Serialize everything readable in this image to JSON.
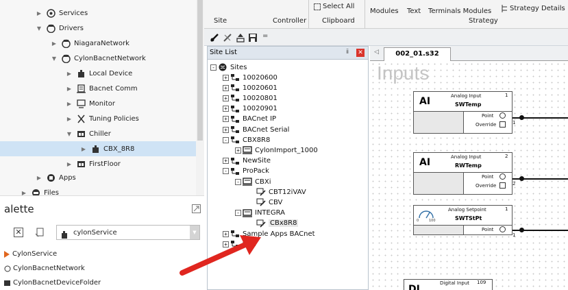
{
  "nav": {
    "items": [
      {
        "label": "Services",
        "icon": "gear-icon",
        "expanded": false
      },
      {
        "label": "Drivers",
        "icon": "driver-icon",
        "expanded": true
      },
      {
        "label": "NiagaraNetwork",
        "icon": "network-icon",
        "expanded": false
      },
      {
        "label": "CylonBacnetNetwork",
        "icon": "network-icon",
        "expanded": true
      },
      {
        "label": "Local Device",
        "icon": "device-icon",
        "expanded": false
      },
      {
        "label": "Bacnet Comm",
        "icon": "comm-icon",
        "expanded": false
      },
      {
        "label": "Monitor",
        "icon": "monitor-icon",
        "expanded": false
      },
      {
        "label": "Tuning Policies",
        "icon": "tuning-icon",
        "expanded": false
      },
      {
        "label": "Chiller",
        "icon": "folder-icon",
        "expanded": true
      },
      {
        "label": "CBX_8R8",
        "icon": "device-icon",
        "expanded": false,
        "selected": true
      },
      {
        "label": "FirstFloor",
        "icon": "folder-icon",
        "expanded": false
      },
      {
        "label": "Apps",
        "icon": "apps-icon",
        "expanded": false
      },
      {
        "label": "Files",
        "icon": "files-icon",
        "expanded": false
      }
    ]
  },
  "palette": {
    "title": "alette",
    "service_select": "cylonService",
    "items": [
      {
        "label": "CylonService",
        "icon": "service-icon"
      },
      {
        "label": "CylonBacnetNetwork",
        "icon": "network-icon"
      },
      {
        "label": "CylonBacnetDeviceFolder",
        "icon": "folder-icon"
      }
    ]
  },
  "ribbon": {
    "groups": [
      "Site",
      "Controller",
      "Clipboard"
    ],
    "select_all": "Select All",
    "modules": "Modules",
    "text": "Text",
    "terminals_modules": "Terminals Modules",
    "strategy_details": "Strategy Details",
    "strategy_group": "Strategy"
  },
  "toolbar2": {
    "overflow": "="
  },
  "sitelist": {
    "title": "Site List",
    "root": "Sites",
    "items": [
      {
        "label": "10020600",
        "level": 1,
        "icon": "site-icon",
        "toggle": "+"
      },
      {
        "label": "10020601",
        "level": 1,
        "icon": "site-icon",
        "toggle": "+"
      },
      {
        "label": "10020801",
        "level": 1,
        "icon": "site-icon",
        "toggle": "+"
      },
      {
        "label": "10020901",
        "level": 1,
        "icon": "site-icon",
        "toggle": "+"
      },
      {
        "label": "BACnet IP",
        "level": 1,
        "icon": "site-icon",
        "toggle": "+"
      },
      {
        "label": "BACnet Serial",
        "level": 1,
        "icon": "site-icon",
        "toggle": "+"
      },
      {
        "label": "CBX8R8",
        "level": 1,
        "icon": "site-icon",
        "toggle": "-"
      },
      {
        "label": "CylonImport_1000",
        "level": 2,
        "icon": "controller-icon",
        "toggle": "+"
      },
      {
        "label": "NewSite",
        "level": 1,
        "icon": "site-icon",
        "toggle": "+"
      },
      {
        "label": "ProPack",
        "level": 1,
        "icon": "site-icon",
        "toggle": "-"
      },
      {
        "label": "CBXi",
        "level": 2,
        "icon": "controller-icon",
        "toggle": "-"
      },
      {
        "label": "CBT12iVAV",
        "level": 3,
        "icon": "pen-icon",
        "toggle": ""
      },
      {
        "label": "CBV",
        "level": 3,
        "icon": "pen-icon",
        "toggle": ""
      },
      {
        "label": "INTEGRA",
        "level": 2,
        "icon": "controller-icon",
        "toggle": "-"
      },
      {
        "label": "CBx8R8",
        "level": 3,
        "icon": "pen-icon",
        "toggle": "",
        "highlight": true
      },
      {
        "label": "Sample Apps BACnet",
        "level": 1,
        "icon": "site-icon",
        "toggle": "+"
      },
      {
        "label": "test",
        "level": 1,
        "icon": "site-icon",
        "toggle": "+"
      }
    ]
  },
  "strategy": {
    "tab": "002_01.s32",
    "section_label": "Inputs",
    "blocks": [
      {
        "kind": "AI",
        "type": "Analog Input",
        "num": "1",
        "name": "SWTemp",
        "rows": [
          "Point",
          "Override"
        ],
        "out": "1"
      },
      {
        "kind": "AI",
        "type": "Analog Input",
        "num": "2",
        "name": "RWTemp",
        "rows": [
          "Point",
          "Override"
        ],
        "out": "2"
      },
      {
        "kind": "gauge",
        "type": "Analog Setpoint",
        "num": "1",
        "name": "SWTStPt",
        "rows": [
          "Point"
        ],
        "out": "1",
        "scale_min": "0",
        "scale_max": "100"
      },
      {
        "kind": "DI",
        "type": "Digital Input",
        "num": "109"
      }
    ]
  },
  "colors": {
    "selection": "#cfe3f5",
    "arrow": "#e0261f",
    "accent": "#2e6da4"
  }
}
